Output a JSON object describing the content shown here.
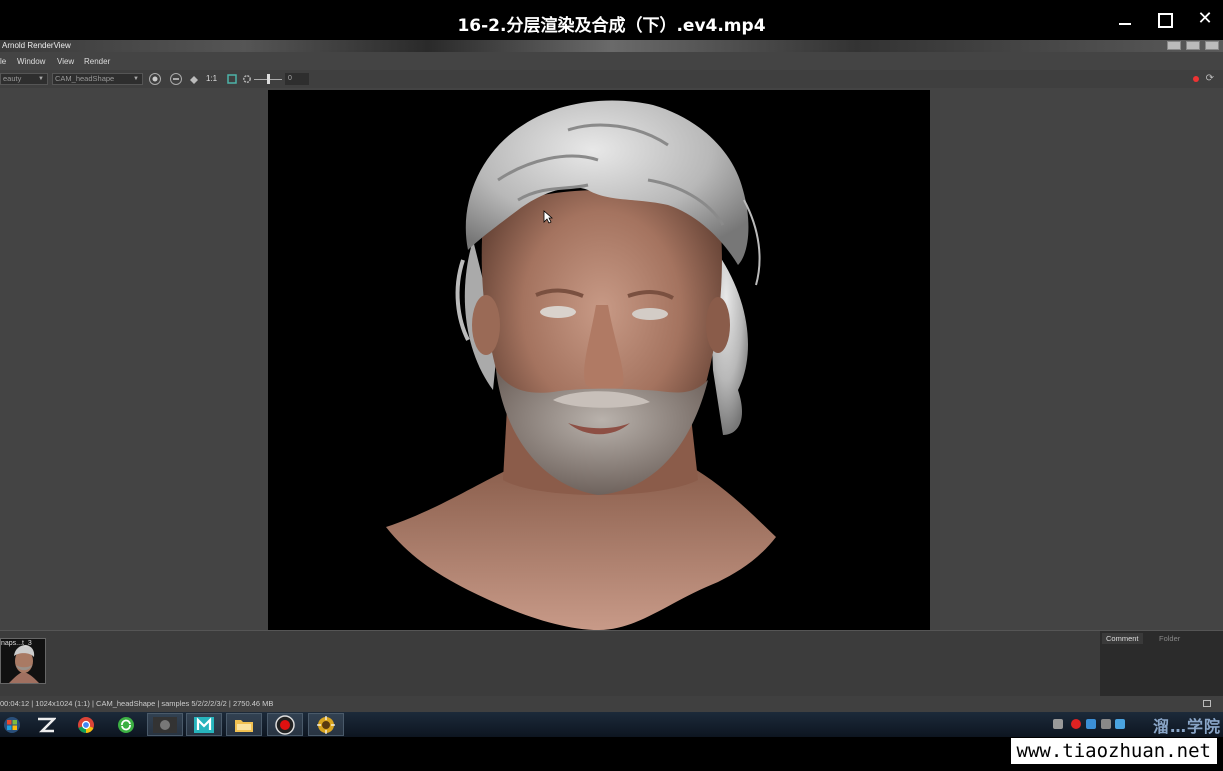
{
  "player": {
    "title": "16-2.分层渲染及合成（下）.ev4.mp4",
    "minimize_icon": "minimize-icon",
    "maximize_icon": "maximize-icon",
    "close_glyph": "✕"
  },
  "arnold": {
    "title": "Arnold RenderView",
    "menu": [
      "le",
      "Window",
      "View",
      "Render"
    ],
    "toolbar": {
      "aov_value": "eauty",
      "camera_value": "CAM_headShape",
      "ratio_label": "1:1",
      "exposure_value": "0"
    },
    "snapshot_label": "naps...t_3",
    "side_tabs": {
      "comment": "Comment",
      "folder": "Folder"
    },
    "status_text": "00:04:12 | 1024x1024 (1:1) | CAM_headShape  | samples 5/2/2/2/3/2 | 2750.46 MB"
  },
  "taskbar": {
    "apps": [
      "windows-start",
      "zbrush",
      "chrome",
      "sync-app",
      "photo-viewer",
      "maya",
      "file-explorer",
      "recorder",
      "arnold-render"
    ],
    "tray_logo": "溜…学院"
  },
  "watermark": "www.tiaozhuan.net",
  "colors": {
    "maya_teal": "#27b4bd",
    "chrome_red": "#db4437",
    "chrome_yellow": "#f4c20d",
    "chrome_green": "#0f9d58",
    "record_red": "#e01010"
  }
}
